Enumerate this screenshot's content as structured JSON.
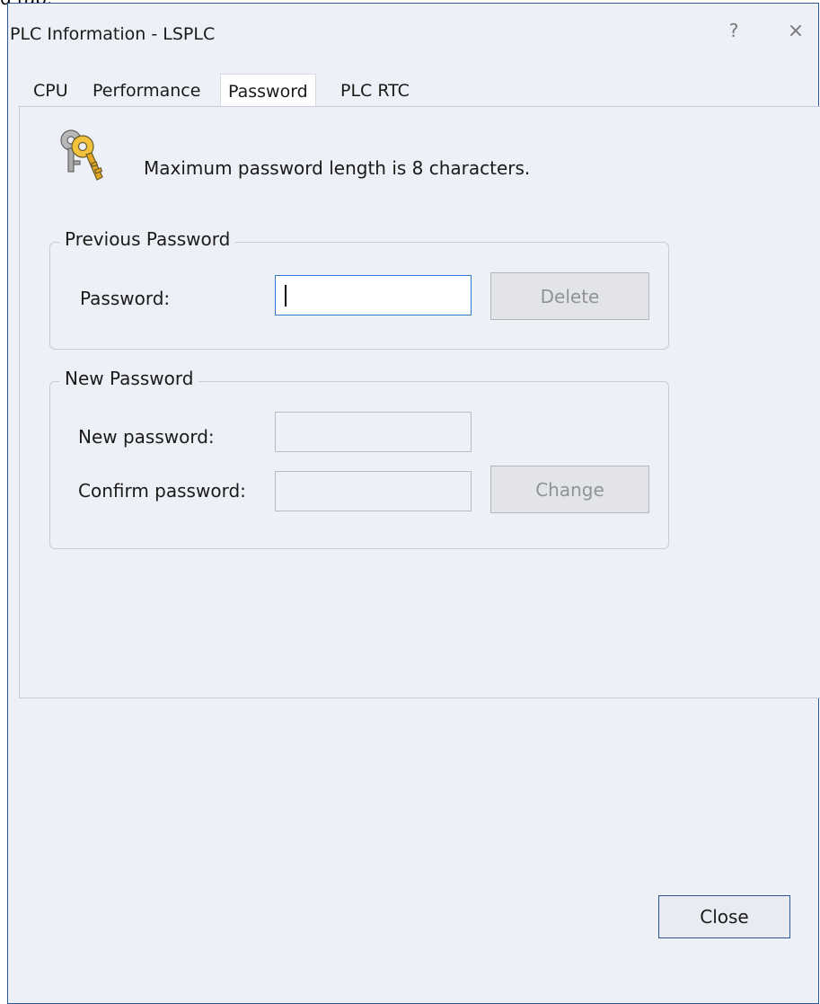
{
  "clipped_text": "d tap.",
  "window": {
    "title": "PLC Information - LSPLC",
    "help_glyph": "?",
    "close_glyph": "×"
  },
  "tabs": [
    {
      "label": "CPU",
      "active": false
    },
    {
      "label": "Performance",
      "active": false
    },
    {
      "label": "Password",
      "active": true
    },
    {
      "label": "PLC RTC",
      "active": false
    }
  ],
  "password_tab": {
    "info_icon": "keys-icon",
    "info_text": "Maximum password length is 8 characters.",
    "previous_group": {
      "title": "Previous Password",
      "password_label": "Password:",
      "password_value": "",
      "delete_button": "Delete"
    },
    "new_group": {
      "title": "New Password",
      "new_label": "New password:",
      "new_value": "",
      "confirm_label": "Confirm password:",
      "confirm_value": "",
      "change_button": "Change"
    }
  },
  "footer": {
    "close_button": "Close"
  },
  "colors": {
    "window_bg": "#eef0f7",
    "window_border": "#2b5797",
    "focus_border": "#2e7bd0",
    "disabled_text": "#8f9297"
  }
}
